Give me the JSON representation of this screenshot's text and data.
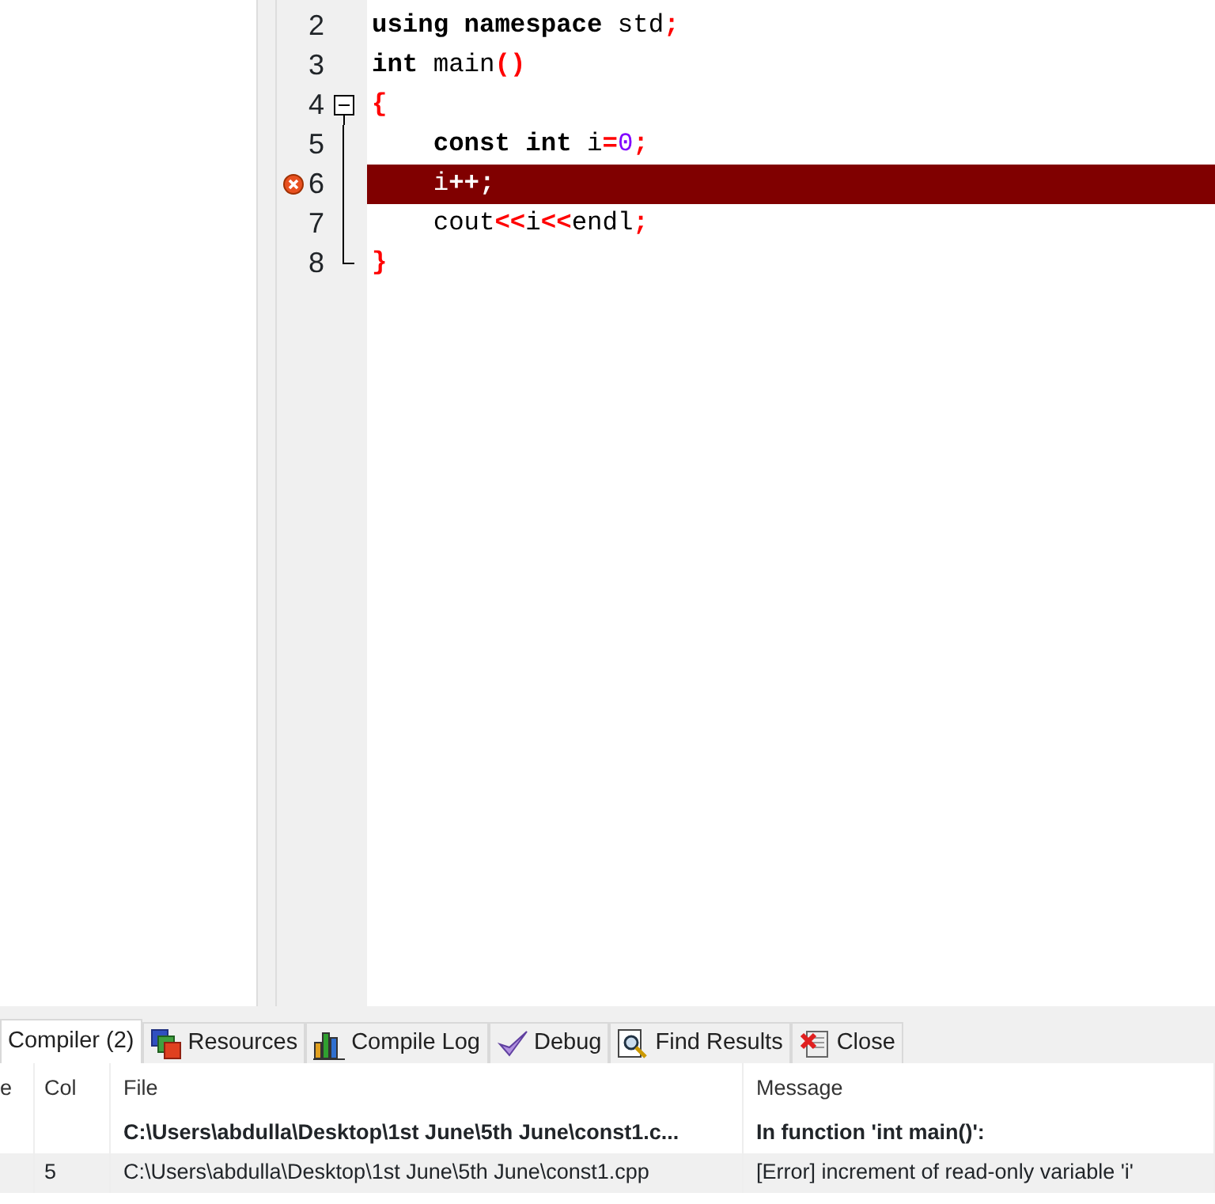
{
  "editor": {
    "lines": [
      {
        "number": "2",
        "kind": "plain",
        "error": false,
        "tokens": [
          {
            "t": "using namespace",
            "kind": "keyword"
          },
          {
            "t": " std",
            "kind": "plain"
          },
          {
            "t": ";",
            "kind": "symbol"
          }
        ]
      },
      {
        "number": "3",
        "kind": "plain",
        "error": false,
        "tokens": [
          {
            "t": "int",
            "kind": "keyword"
          },
          {
            "t": " main",
            "kind": "plain"
          },
          {
            "t": "()",
            "kind": "symbol"
          }
        ]
      },
      {
        "number": "4",
        "kind": "foldstart",
        "error": false,
        "tokens": [
          {
            "t": "{",
            "kind": "symbol"
          }
        ]
      },
      {
        "number": "5",
        "kind": "foldbody",
        "error": false,
        "tokens": [
          {
            "t": "    const int",
            "kind": "keyword"
          },
          {
            "t": " i",
            "kind": "plain"
          },
          {
            "t": "=",
            "kind": "symbol"
          },
          {
            "t": "0",
            "kind": "number"
          },
          {
            "t": ";",
            "kind": "symbol"
          }
        ]
      },
      {
        "number": "6",
        "kind": "foldbody",
        "error": true,
        "tokens": [
          {
            "t": "    i",
            "kind": "plain"
          },
          {
            "t": "++;",
            "kind": "symbol"
          }
        ]
      },
      {
        "number": "7",
        "kind": "foldbody",
        "error": false,
        "tokens": [
          {
            "t": "    cout",
            "kind": "plain"
          },
          {
            "t": "<<",
            "kind": "symbol"
          },
          {
            "t": "i",
            "kind": "plain"
          },
          {
            "t": "<<",
            "kind": "symbol"
          },
          {
            "t": "endl",
            "kind": "plain"
          },
          {
            "t": ";",
            "kind": "symbol"
          }
        ]
      },
      {
        "number": "8",
        "kind": "foldend",
        "error": false,
        "tokens": [
          {
            "t": "}",
            "kind": "symbol"
          }
        ]
      }
    ]
  },
  "tabs": [
    {
      "label": "Compiler (2)",
      "selected": true
    },
    {
      "label": "Resources",
      "selected": false
    },
    {
      "label": "Compile Log",
      "selected": false
    },
    {
      "label": "Debug",
      "selected": false
    },
    {
      "label": "Find Results",
      "selected": false
    },
    {
      "label": "Close",
      "selected": false
    }
  ],
  "table": {
    "columns": [
      "e",
      "Col",
      "File",
      "Message"
    ],
    "rows": [
      {
        "cells": [
          "",
          "",
          "C:\\Users\\abdulla\\Desktop\\1st June\\5th June\\const1.c...",
          "In function 'int main()':"
        ],
        "bold": true,
        "selected": false
      },
      {
        "cells": [
          "",
          "5",
          "C:\\Users\\abdulla\\Desktop\\1st June\\5th June\\const1.cpp",
          "[Error] increment of read-only variable 'i'"
        ],
        "bold": false,
        "selected": true
      }
    ]
  }
}
